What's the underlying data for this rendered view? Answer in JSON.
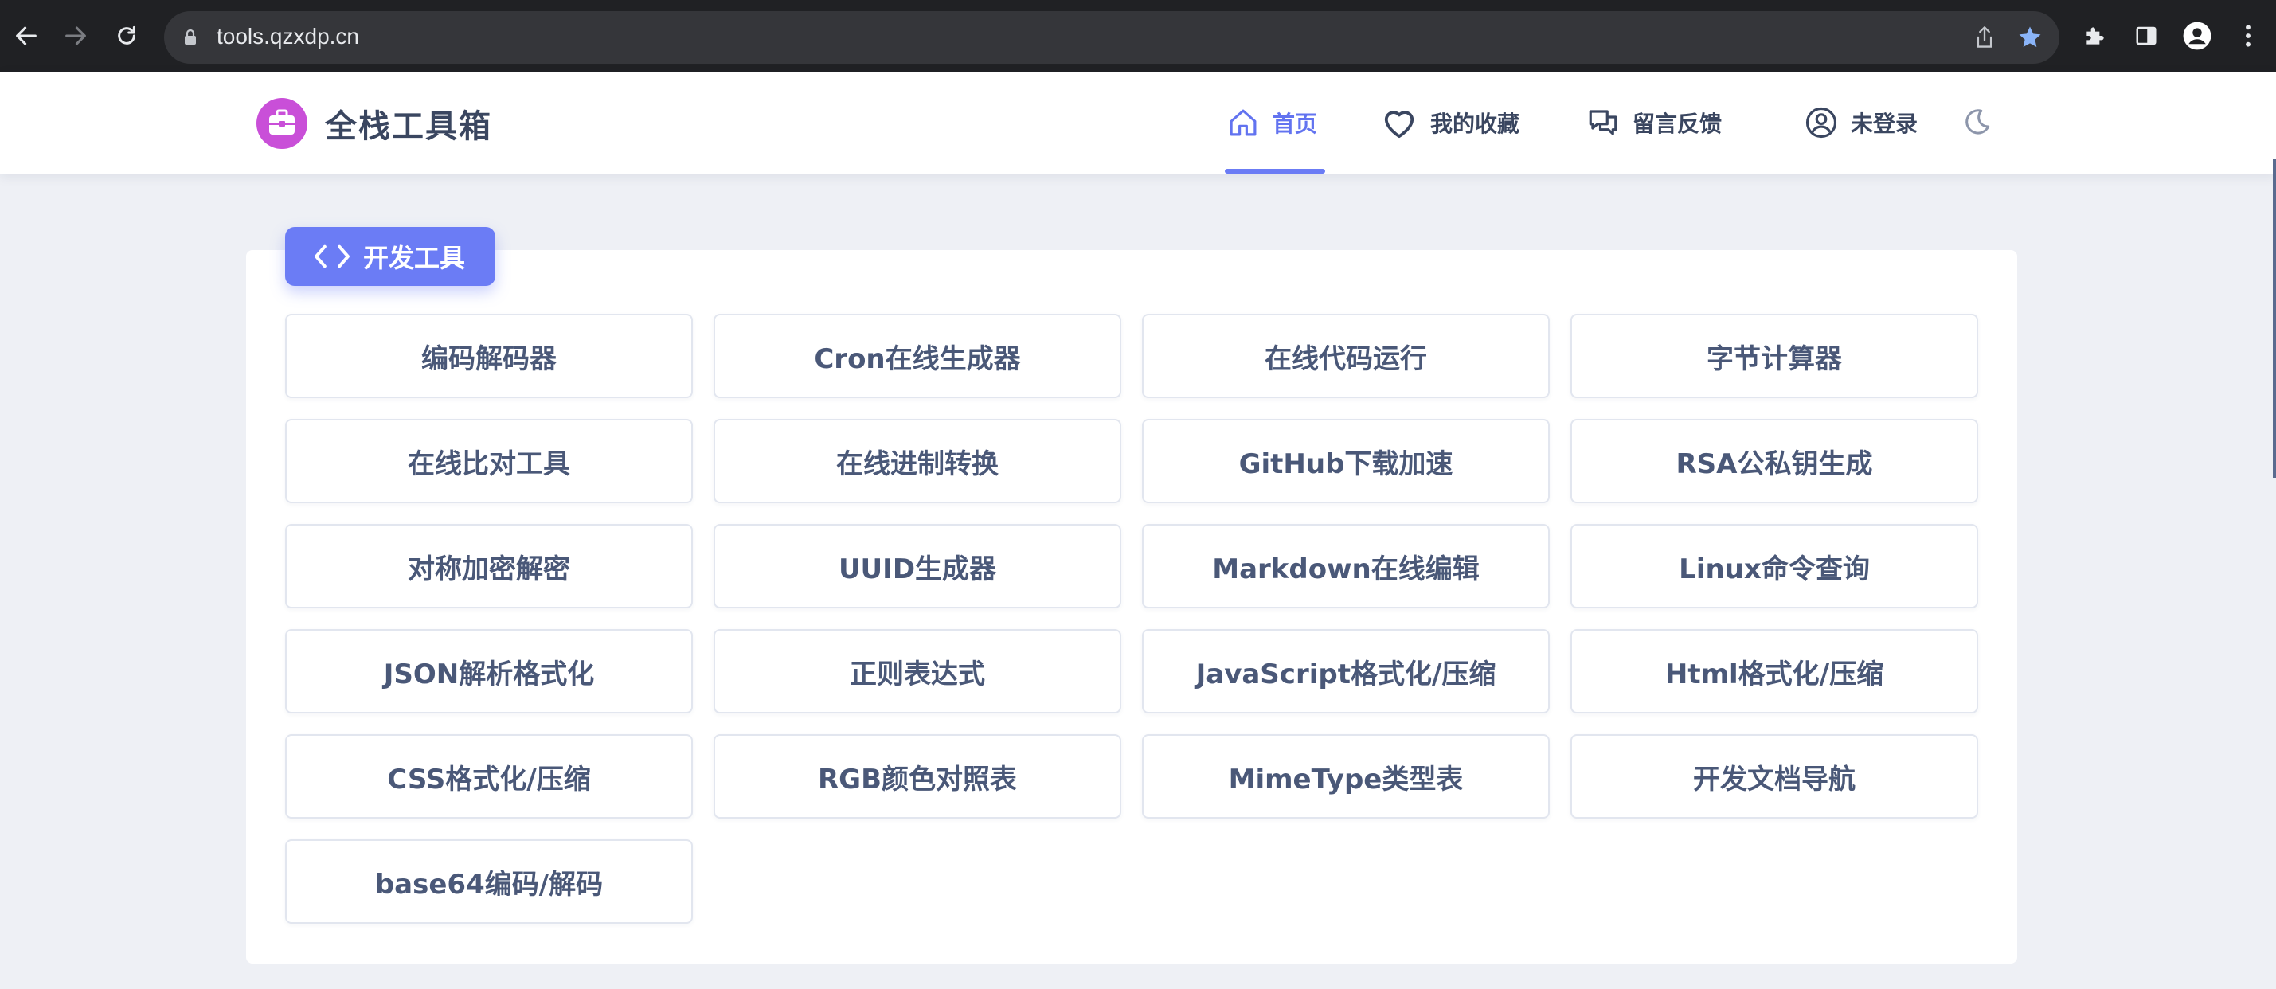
{
  "browser": {
    "url": "tools.qzxdp.cn"
  },
  "header": {
    "site_title": "全栈工具箱",
    "nav": [
      {
        "label": "首页",
        "icon": "home-icon",
        "active": true
      },
      {
        "label": "我的收藏",
        "icon": "heart-icon"
      },
      {
        "label": "留言反馈",
        "icon": "chat-icon"
      },
      {
        "label": "未登录",
        "icon": "user-icon"
      }
    ],
    "accent_color": "#6b7cf5"
  },
  "section": {
    "title": "开发工具",
    "icon": "code-icon"
  },
  "tools": [
    "编码解码器",
    "Cron在线生成器",
    "在线代码运行",
    "字节计算器",
    "在线比对工具",
    "在线进制转换",
    "GitHub下载加速",
    "RSA公私钥生成",
    "对称加密解密",
    "UUID生成器",
    "Markdown在线编辑",
    "Linux命令查询",
    "JSON解析格式化",
    "正则表达式",
    "JavaScript格式化/压缩",
    "Html格式化/压缩",
    "CSS格式化/压缩",
    "RGB颜色对照表",
    "MimeType类型表",
    "开发文档导航",
    "base64编码/解码"
  ]
}
